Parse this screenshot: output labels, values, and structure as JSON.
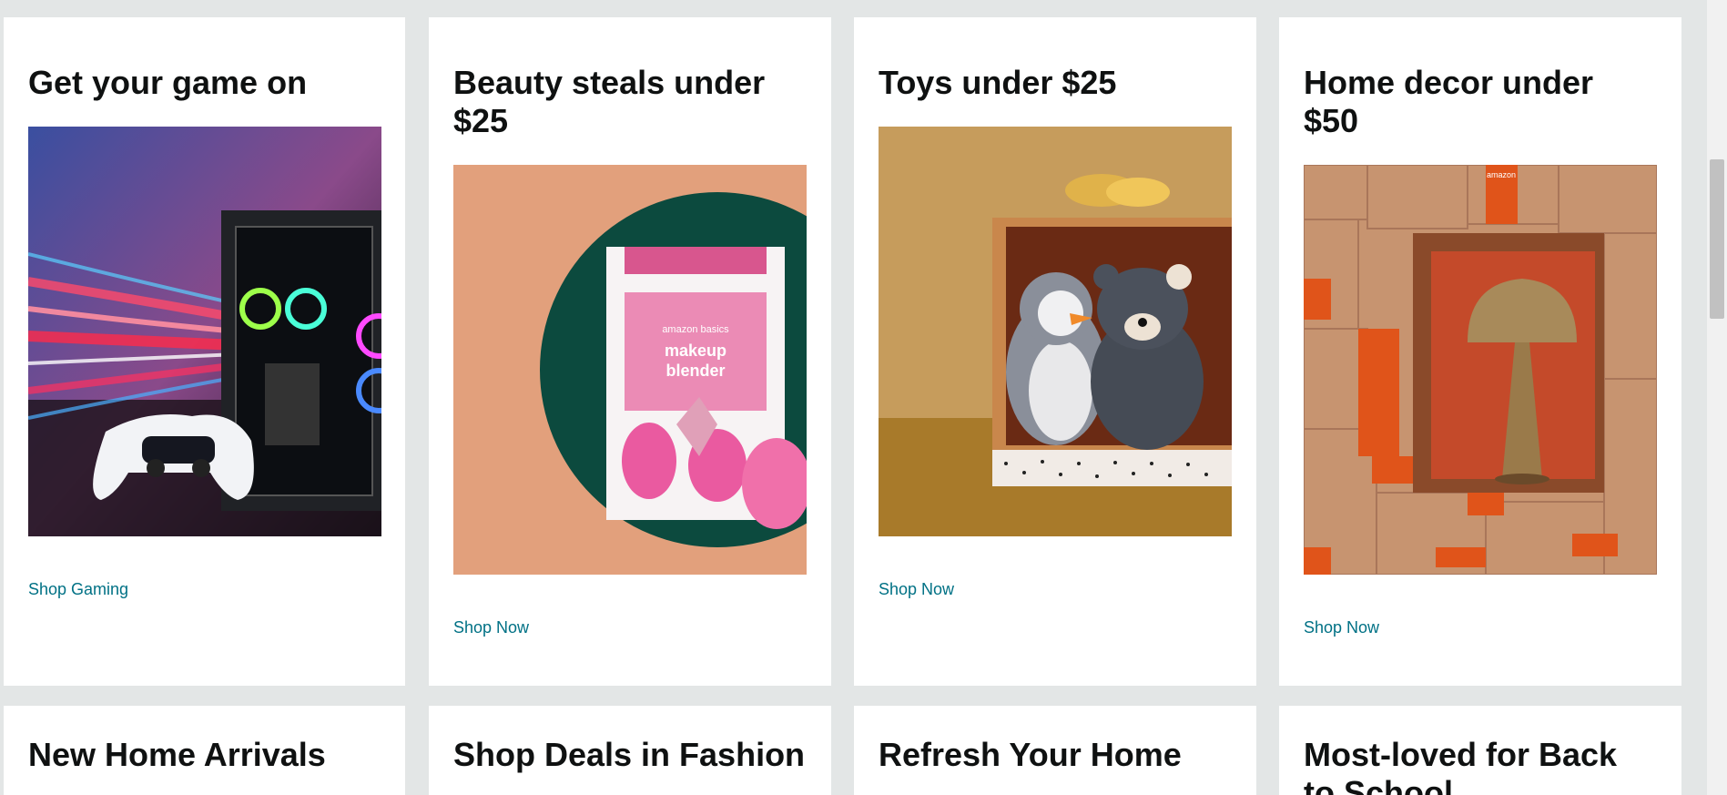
{
  "cards_row1": [
    {
      "title": "Get your game on",
      "link": "Shop Gaming",
      "image": "gaming-pc-controller-image"
    },
    {
      "title": "Beauty steals under $25",
      "link": "Shop Now",
      "image": "makeup-blender-image"
    },
    {
      "title": "Toys under $25",
      "link": "Shop Now",
      "image": "plush-toys-gift-box-image"
    },
    {
      "title": "Home decor under $50",
      "link": "Shop Now",
      "image": "lamp-in-boxes-image"
    }
  ],
  "cards_row2": [
    {
      "title": "New Home Arrivals"
    },
    {
      "title": "Shop Deals in Fashion"
    },
    {
      "title": "Refresh Your Home"
    },
    {
      "title": "Most-loved for Back to School"
    }
  ],
  "product_text": {
    "brand": "amazon basics",
    "name_line1": "makeup",
    "name_line2": "blender",
    "box_brand": "amazon"
  },
  "colors": {
    "background": "#e3e6e6",
    "link": "#007185",
    "title": "#0f1111"
  }
}
